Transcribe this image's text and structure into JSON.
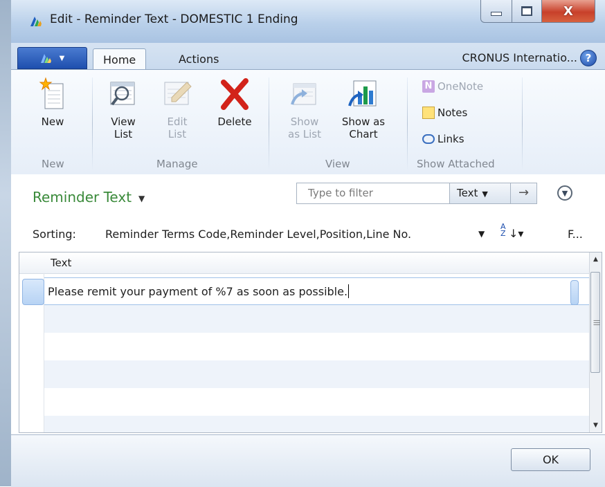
{
  "window": {
    "title": "Edit - Reminder Text - DOMESTIC 1 Ending",
    "controls": {
      "minimize": "minimize",
      "maximize": "maximize",
      "close": "X"
    }
  },
  "ribbon": {
    "tabs": [
      {
        "label": "Home",
        "active": true
      },
      {
        "label": "Actions",
        "active": false
      }
    ],
    "company": "CRONUS Internatio...",
    "help": "?",
    "groups": [
      {
        "label": "New"
      },
      {
        "label": "Manage"
      },
      {
        "label": "View"
      },
      {
        "label": "Show Attached"
      }
    ],
    "buttons": {
      "new": {
        "line1": "New",
        "line2": ""
      },
      "view_list": {
        "line1": "View",
        "line2": "List"
      },
      "edit_list": {
        "line1": "Edit",
        "line2": "List"
      },
      "delete": {
        "line1": "Delete",
        "line2": ""
      },
      "show_as_list": {
        "line1": "Show",
        "line2": "as List"
      },
      "show_as_chart": {
        "line1": "Show as",
        "line2": "Chart"
      },
      "onenote": "OneNote",
      "notes": "Notes",
      "links": "Links"
    }
  },
  "page": {
    "title": "Reminder Text",
    "filter_placeholder": "Type to filter",
    "filter_field": "Text",
    "sorting_label": "Sorting:",
    "sorting_value": "Reminder Terms Code,Reminder Level,Position,Line No.",
    "more": "F..."
  },
  "grid": {
    "columns": [
      "Text"
    ],
    "rows": [
      "Please remit your payment of %7 as soon as possible."
    ]
  },
  "footer": {
    "ok": "OK"
  },
  "colors": {
    "page_title": "#3a8a3a",
    "app_menu": "#1e4fae",
    "close_button": "#c8402a"
  }
}
